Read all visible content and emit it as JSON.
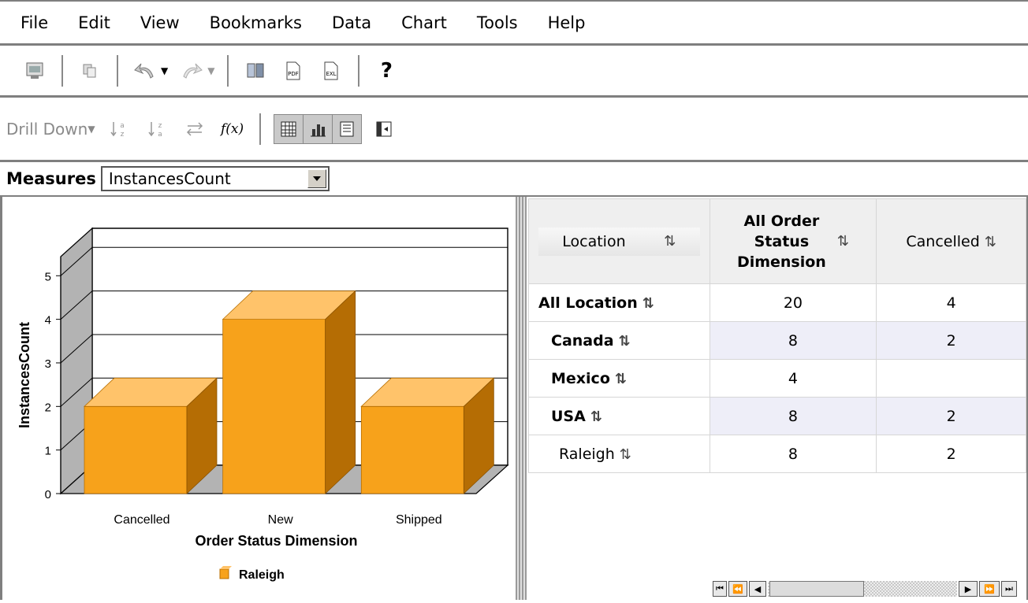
{
  "menu": [
    "File",
    "Edit",
    "View",
    "Bookmarks",
    "Data",
    "Chart",
    "Tools",
    "Help"
  ],
  "toolbar": {
    "help_label": "?",
    "pdf_label": "PDF",
    "excel_label": "EXL"
  },
  "analysis": {
    "drill_label": "Drill Down",
    "formula_label": "f(x)"
  },
  "measures": {
    "label": "Measures",
    "selected": "InstancesCount"
  },
  "chart_data": {
    "type": "bar",
    "categories": [
      "Cancelled",
      "New",
      "Shipped"
    ],
    "series": [
      {
        "name": "Raleigh",
        "values": [
          2,
          4,
          2
        ]
      }
    ],
    "xlabel": "Order Status Dimension",
    "ylabel": "InstancesCount",
    "ylim": [
      0,
      5
    ],
    "yticks": [
      "0",
      "1",
      "2",
      "3",
      "4",
      "5"
    ],
    "grid": true,
    "legend": "bottom",
    "color": "#f7a21b"
  },
  "grid": {
    "col_location": "Location",
    "col_all_lines": [
      "All Order",
      "Status",
      "Dimension"
    ],
    "col_cancelled": "Cancelled",
    "rows": [
      {
        "label": "All Location",
        "all": "20",
        "cancelled": "4"
      },
      {
        "label": "Canada",
        "all": "8",
        "cancelled": "2"
      },
      {
        "label": "Mexico",
        "all": "4",
        "cancelled": ""
      },
      {
        "label": "USA",
        "all": "8",
        "cancelled": "2"
      },
      {
        "label": "Raleigh",
        "all": "8",
        "cancelled": "2"
      }
    ]
  },
  "sort_glyph": "⇅"
}
